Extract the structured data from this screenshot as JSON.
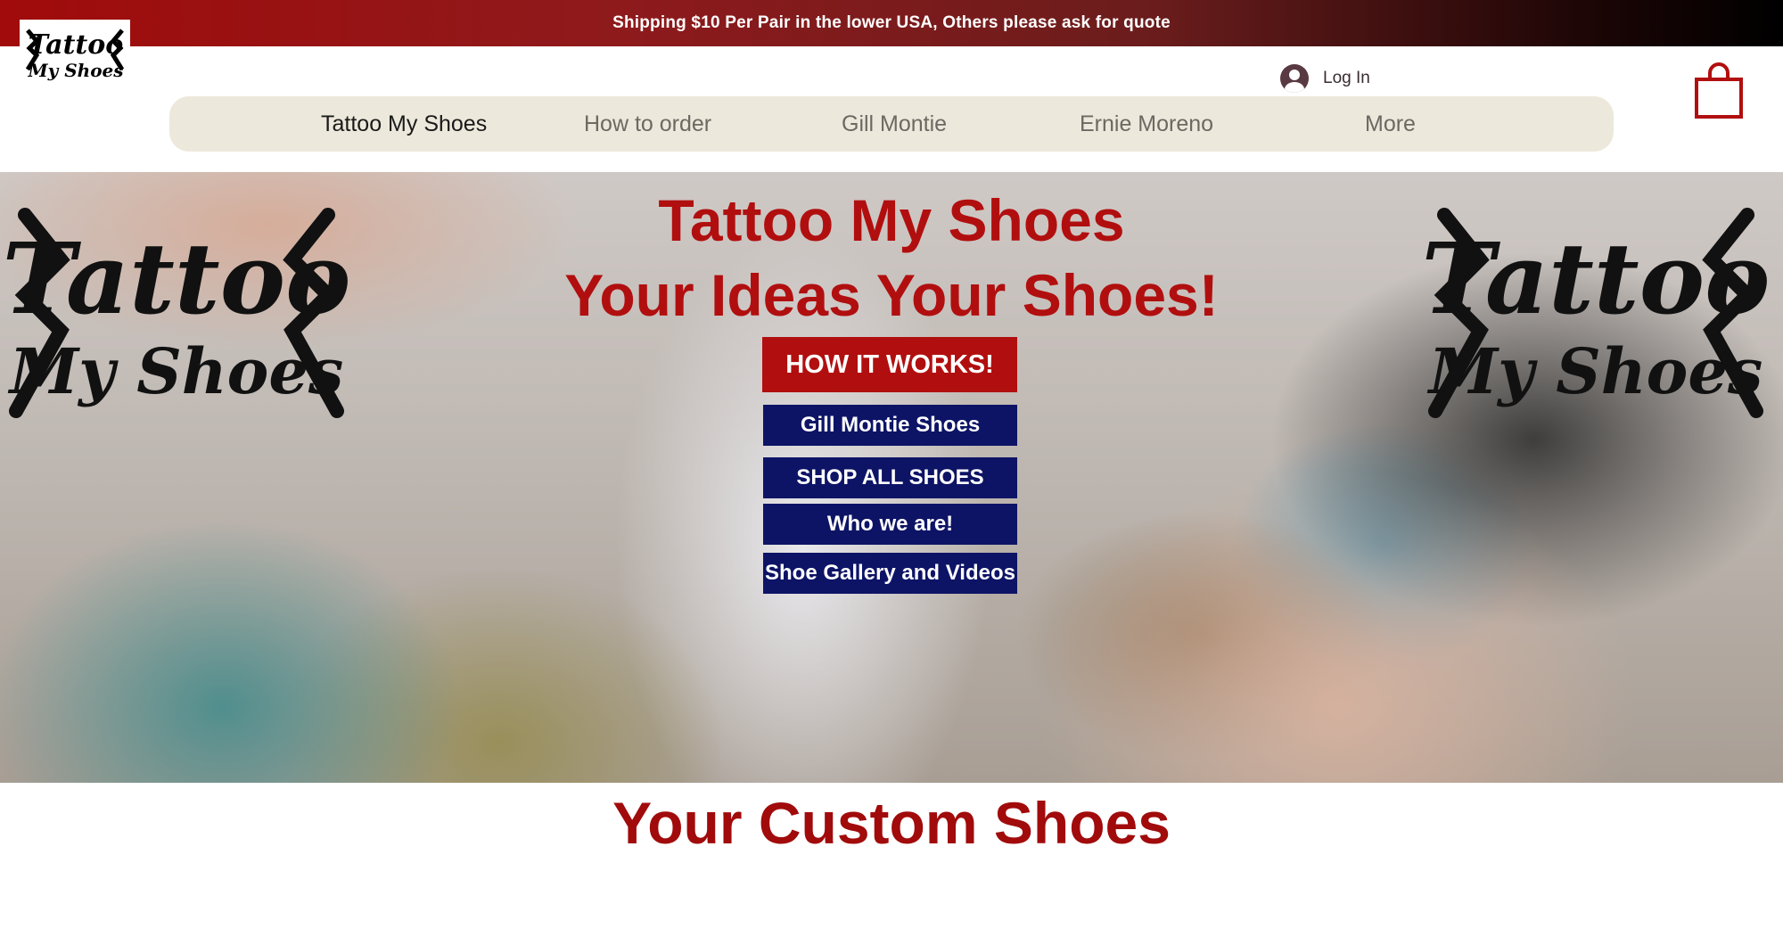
{
  "banner": {
    "text": "Shipping $10 Per Pair in the lower USA, Others please ask for quote"
  },
  "logo": {
    "line1": "Tattoo",
    "line2": "My Shoes"
  },
  "header": {
    "login_label": "Log In"
  },
  "nav": {
    "items": [
      {
        "label": "Tattoo My Shoes"
      },
      {
        "label": "How to order"
      },
      {
        "label": "Gill Montie"
      },
      {
        "label": "Ernie Moreno"
      },
      {
        "label": "More"
      }
    ]
  },
  "hero": {
    "title_line1": "Tattoo My Shoes",
    "title_line2": "Your Ideas Your Shoes!",
    "primary_button": "HOW IT WORKS!",
    "buttons": [
      {
        "label": "Gill Montie Shoes"
      },
      {
        "label": "SHOP ALL SHOES"
      },
      {
        "label": "Who we are!"
      },
      {
        "label": "Shoe Gallery and Videos"
      }
    ]
  },
  "section": {
    "title": "Your Custom Shoes"
  },
  "colors": {
    "brand_red": "#b10f0f",
    "button_blue": "#0d1466",
    "nav_background": "#ece8db"
  }
}
